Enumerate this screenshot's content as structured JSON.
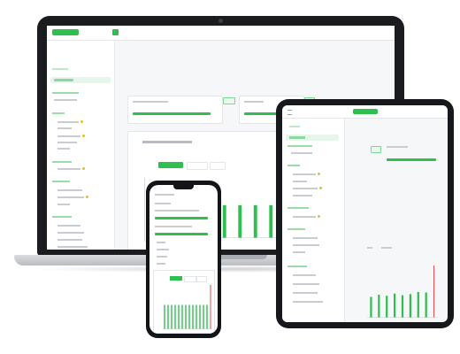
{
  "colors": {
    "accent": "#2fbf4f",
    "accent_light": "#e6f6ea",
    "alert": "#e5474b",
    "warning_dot": "#f2c200",
    "device_frame": "#1b1c1f"
  },
  "icons": [
    "menu-icon",
    "camera-icon"
  ],
  "laptop": {
    "chart_bar_levels": [
      0.62,
      0.62,
      0.62,
      0.62
    ],
    "sidebar_sections": 5
  },
  "tablet": {
    "chart_bar_levels": [
      0.38,
      0.42,
      0.4,
      0.44,
      0.41,
      0.43,
      0.47,
      0.46
    ],
    "alert_bar_level": 0.95
  },
  "phone": {
    "chart_bar_levels": [
      0.55,
      0.55,
      0.55,
      0.55,
      0.55,
      0.55,
      0.55,
      0.55,
      0.55,
      0.55,
      0.55,
      0.55,
      0.55
    ],
    "alert_bar_level": 1.0
  }
}
